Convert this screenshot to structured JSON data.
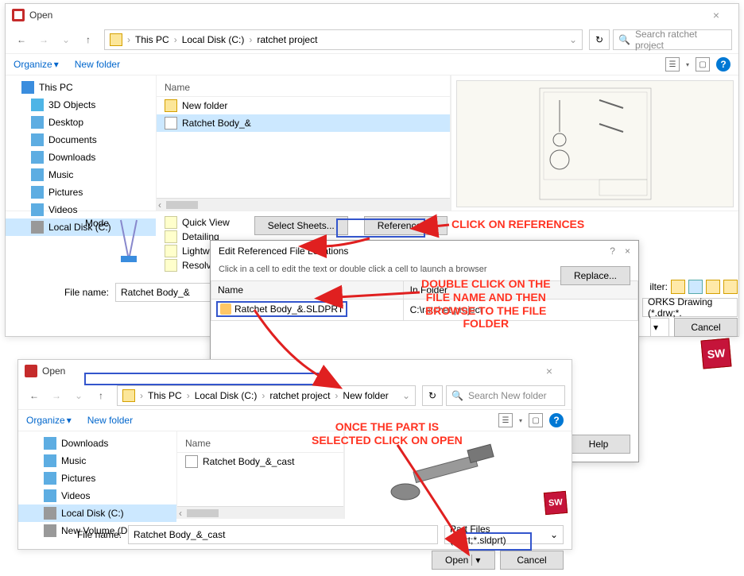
{
  "window1": {
    "title": "Open",
    "breadcrumb": [
      "This PC",
      "Local Disk (C:)",
      "ratchet project"
    ],
    "search_placeholder": "Search ratchet project",
    "toolbar": {
      "organize": "Organize",
      "newfolder": "New folder"
    },
    "tree": [
      {
        "label": "This PC",
        "icon": "pc"
      },
      {
        "label": "3D Objects",
        "icon": "obj"
      },
      {
        "label": "Desktop",
        "icon": "desk"
      },
      {
        "label": "Documents",
        "icon": "doc"
      },
      {
        "label": "Downloads",
        "icon": "down"
      },
      {
        "label": "Music",
        "icon": "music"
      },
      {
        "label": "Pictures",
        "icon": "pic"
      },
      {
        "label": "Videos",
        "icon": "vid"
      },
      {
        "label": "Local Disk (C:)",
        "icon": "disk",
        "selected": true
      }
    ],
    "list_header": "Name",
    "files": [
      {
        "label": "New folder",
        "icon": "folder"
      },
      {
        "label": "Ratchet Body_&",
        "icon": "part",
        "selected": true
      }
    ],
    "mode_label": "Mode",
    "modes": [
      "Quick View",
      "Detailing",
      "Lightweight",
      "Resolved"
    ],
    "select_sheets": "Select Sheets...",
    "references": "References...",
    "filename_label": "File name:",
    "filename_value": "Ratchet Body_&",
    "filter_label": "ilter:",
    "filetype": "ORKS Drawing (*.drw;*.",
    "cancel": "Cancel"
  },
  "refdialog": {
    "title": "Edit Referenced File Locations",
    "hint": "Click in a cell to edit the text or double click a cell to launch a browser",
    "col_name": "Name",
    "col_folder": "In Folder",
    "row_name": "Ratchet Body_&.SLDPRT",
    "row_folder": "C:\\ratchet project",
    "replace": "Replace...",
    "help": "Help"
  },
  "window2": {
    "title": "Open",
    "breadcrumb": [
      "This PC",
      "Local Disk (C:)",
      "ratchet project",
      "New folder"
    ],
    "search_placeholder": "Search New folder",
    "toolbar": {
      "organize": "Organize",
      "newfolder": "New folder"
    },
    "tree": [
      {
        "label": "Downloads",
        "icon": "down"
      },
      {
        "label": "Music",
        "icon": "music"
      },
      {
        "label": "Pictures",
        "icon": "pic"
      },
      {
        "label": "Videos",
        "icon": "vid"
      },
      {
        "label": "Local Disk (C:)",
        "icon": "disk",
        "selected": true
      },
      {
        "label": "New Volume (D:)",
        "icon": "disk"
      }
    ],
    "list_header": "Name",
    "files": [
      {
        "label": "Ratchet Body_&_cast",
        "icon": "part"
      }
    ],
    "filename_label": "File name:",
    "filename_value": "Ratchet Body_&_cast",
    "filetype": "Part Files (*.prt;*.sldprt)",
    "open": "Open",
    "cancel": "Cancel"
  },
  "annotations": {
    "a1": "CLICK ON REFERENCES",
    "a2": "DOUBLE CLICK ON THE\nFILE NAME AND THEN\nBROWSE TO THE FILE\nFOLDER",
    "a3": "ONCE THE PART IS\nSELECTED CLICK ON OPEN"
  }
}
